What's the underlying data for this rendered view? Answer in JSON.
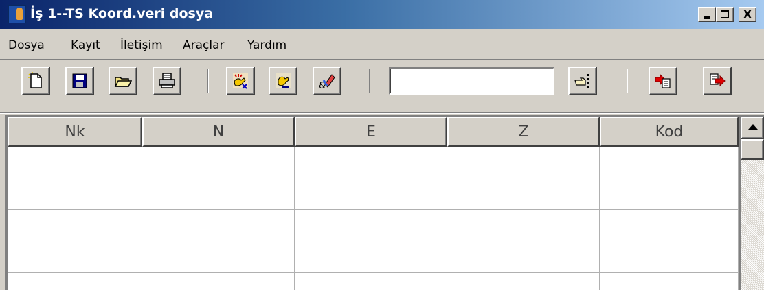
{
  "window": {
    "title": "İş 1--TS Koord.veri dosya",
    "minimize_glyph": "",
    "maximize_glyph": "",
    "close_glyph": "X"
  },
  "menu": {
    "items": [
      {
        "label": "Dosya"
      },
      {
        "label": "Kayıt"
      },
      {
        "label": "İletişim"
      },
      {
        "label": "Araçlar"
      },
      {
        "label": "Yardım"
      }
    ]
  },
  "toolbar": {
    "buttons": [
      {
        "icon": "new-file-icon"
      },
      {
        "icon": "save-icon"
      },
      {
        "icon": "open-folder-icon"
      },
      {
        "icon": "print-icon"
      },
      {
        "icon": "select-all-icon"
      },
      {
        "icon": "select-icon"
      },
      {
        "icon": "clear-eraser-icon"
      },
      {
        "icon": "go-pointer-icon"
      },
      {
        "icon": "import-icon"
      },
      {
        "icon": "export-icon"
      }
    ],
    "search_value": ""
  },
  "grid": {
    "columns": [
      "Nk",
      "N",
      "E",
      "Z",
      "Kod"
    ],
    "rows": [
      [
        "",
        "",
        "",
        "",
        ""
      ],
      [
        "",
        "",
        "",
        "",
        ""
      ],
      [
        "",
        "",
        "",
        "",
        ""
      ],
      [
        "",
        "",
        "",
        "",
        ""
      ],
      [
        "",
        "",
        "",
        "",
        ""
      ]
    ]
  },
  "colors": {
    "title_bar_start": "#0a246a",
    "title_bar_end": "#a6caf0",
    "face": "#d4d0c8"
  }
}
